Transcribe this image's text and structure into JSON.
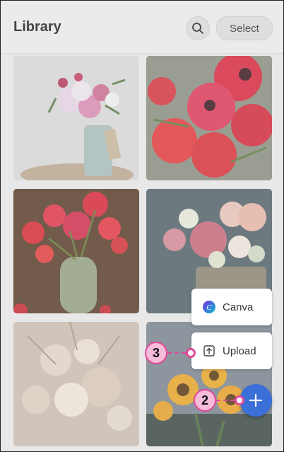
{
  "header": {
    "title": "Library",
    "select_label": "Select",
    "search_icon": "search-icon"
  },
  "menu": {
    "canva_label": "Canva",
    "upload_label": "Upload",
    "canva_icon": "canva-logo-icon",
    "upload_icon": "upload-icon"
  },
  "fab": {
    "icon": "plus-icon"
  },
  "callouts": {
    "upload": "3",
    "fab": "2"
  },
  "colors": {
    "accent": "#3a6fd8",
    "callout": "#e0479a",
    "callout_fill": "#f7bcd9"
  }
}
